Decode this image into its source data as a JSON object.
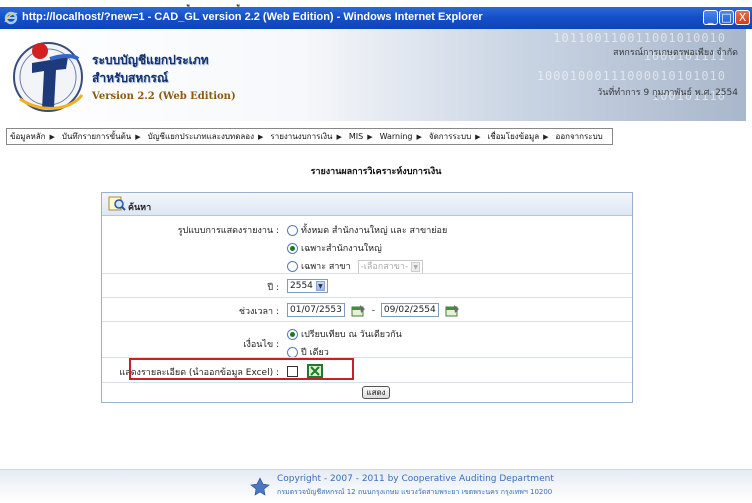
{
  "window": {
    "title": "http://localhost/?new=1 - CAD_GL version 2.2 (Web Edition) - Windows Internet Explorer",
    "minimize": "_",
    "maximize": "□",
    "close": "X"
  },
  "header": {
    "org_line1": "ระบบบัญชีแยกประเภท",
    "org_line2": "สำหรับสหกรณ์",
    "version": "Version 2.2 (Web Edition)",
    "coop_name": "สหกรณ์การเกษตรพอเพียง จำกัด",
    "work_date": "วันที่ทำการ 9 กุมภาพันธ์ พ.ศ. 2554",
    "binary_rows": [
      "101100110011001010010",
      "1000101111",
      "10001000111000010101010",
      "100101110"
    ]
  },
  "menu": {
    "items": [
      "ข้อมูลหลัก",
      "บันทึกรายการขั้นต้น",
      "บัญชีแยกประเภทและงบทดลอง",
      "รายงานงบการเงิน",
      "MIS",
      "Warning",
      "จัดการระบบ",
      "เชื่อมโยงข้อมูล",
      "ออกจากระบบ"
    ]
  },
  "page": {
    "report_title": "รายงานผลการวิเคราะห์งบการเงิน"
  },
  "search_panel": {
    "title": "ค้นหา",
    "display_format": {
      "label": "รูปแบบการแสดงรายงาน :",
      "option_all": "ทั้งหมด สำนักงานใหญ่ และ สาขาย่อย",
      "option_hq": "เฉพาะสำนักงานใหญ่",
      "option_branch": "เฉพาะ สาขา",
      "branch_select_placeholder": "-เลือกสาขา-",
      "selected": "hq"
    },
    "year": {
      "label": "ปี :",
      "value": "2554"
    },
    "period": {
      "label": "ช่วงเวลา :",
      "from": "01/07/2553",
      "separator": "-",
      "to": "09/02/2554"
    },
    "condition": {
      "label": "เงื่อนไข :",
      "option_compare": "เปรียบเทียบ ณ วันเดียวกัน",
      "option_single": "ปี เดียว",
      "selected": "compare"
    },
    "detail": {
      "label": "แสดงรายละเอียด (นำออกข้อมูล Excel) :",
      "checked": false
    },
    "show_button": "แสดง"
  },
  "footer": {
    "copyright": "Copyright - 2007 - 2011  by Cooperative Auditing Department",
    "address": "กรมตรวจบัญชีสหกรณ์ 12 ถนนกรุงเกษม แขวงวัดสามพระยา เขตพระนคร กรุงเทพฯ 10200"
  },
  "colors": {
    "title_bar": "#1550c8",
    "highlight_border": "#c8202a",
    "footer_text": "#3b6fb5"
  }
}
